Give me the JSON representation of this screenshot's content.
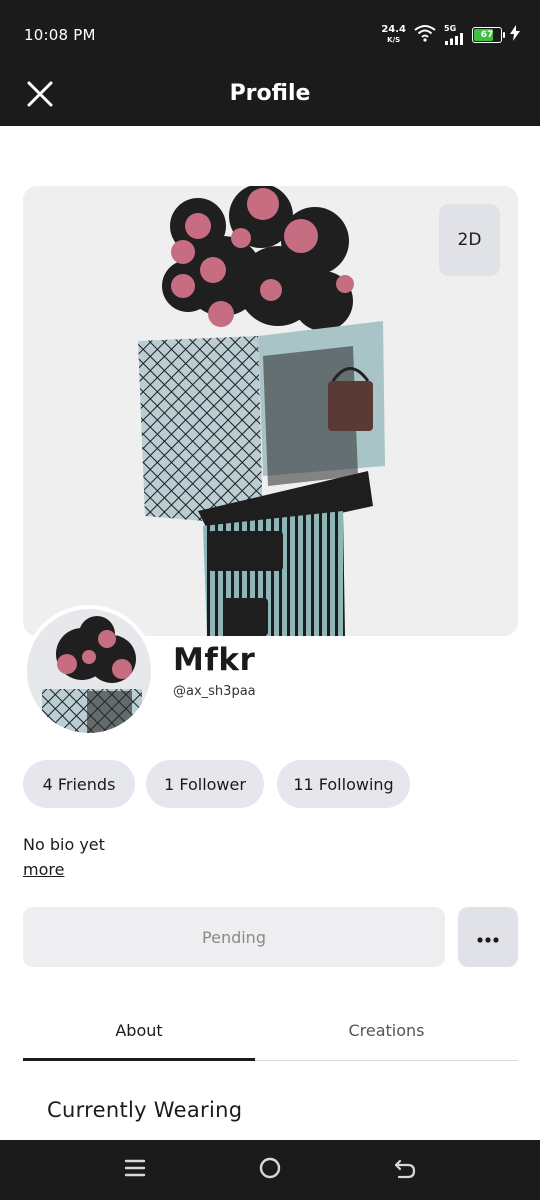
{
  "status_bar": {
    "time": "10:08 PM",
    "net_speed_value": "24.4",
    "net_speed_unit": "K/S",
    "network_type": "5G",
    "battery_percent": "67",
    "battery_level": 0.67,
    "icons": [
      "wifi-icon",
      "cell-signal-icon",
      "battery-icon",
      "charging-bolt-icon"
    ]
  },
  "header": {
    "title": "Profile",
    "close_icon": "close-icon"
  },
  "avatar": {
    "view_toggle_label": "2D"
  },
  "profile": {
    "display_name": "Mfkr",
    "username": "@ax_sh3paa"
  },
  "stats": {
    "friends": "4 Friends",
    "followers": "1 Follower",
    "following": "11 Following"
  },
  "bio": {
    "text": "No bio yet",
    "more_label": "more"
  },
  "actions": {
    "pending_label": "Pending",
    "more_icon": "ellipsis-icon"
  },
  "tabs": [
    {
      "label": "About",
      "active": true
    },
    {
      "label": "Creations",
      "active": false
    }
  ],
  "section": {
    "title": "Currently Wearing"
  },
  "nav": {
    "icons": [
      "menu-icon",
      "home-circle-icon",
      "back-icon"
    ]
  },
  "colors": {
    "bar_bg": "#1b1b1b",
    "chip_bg": "#e6e7ec",
    "battery_green": "#3fbf3f"
  }
}
